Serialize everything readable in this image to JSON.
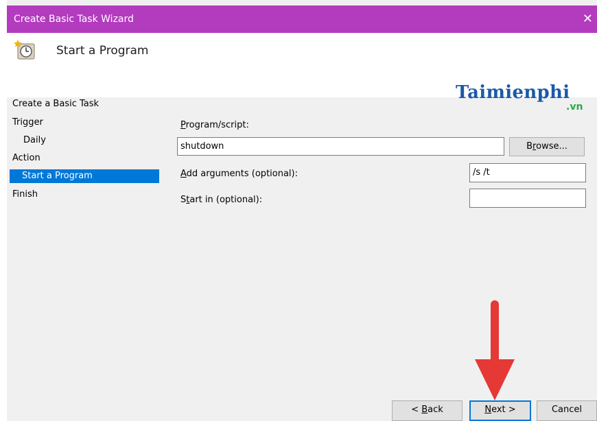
{
  "window": {
    "title": "Create Basic Task Wizard",
    "close_glyph": "✕"
  },
  "header": {
    "heading": "Start a Program"
  },
  "logo": {
    "text": "Taimienphi",
    "suffix": ".vn"
  },
  "nav": {
    "items": [
      {
        "label": "Create a Basic Task"
      },
      {
        "label": "Trigger"
      },
      {
        "label": "Daily"
      },
      {
        "label": "Action"
      },
      {
        "label": "Start a Program"
      },
      {
        "label": "Finish"
      }
    ]
  },
  "form": {
    "program_label_key": "P",
    "program_label_rest": "rogram/script:",
    "program_value": "shutdown",
    "browse_key": "r",
    "browse_pre": "B",
    "browse_post": "owse...",
    "args_label_key": "A",
    "args_label_rest": "dd arguments (optional):",
    "args_value": "/s /t",
    "startin_label_pre": "S",
    "startin_label_key": "t",
    "startin_label_rest": "art in (optional):",
    "startin_value": ""
  },
  "footer": {
    "back_pre": "< ",
    "back_key": "B",
    "back_rest": "ack",
    "next_key": "N",
    "next_rest": "ext >",
    "cancel_label": "Cancel"
  },
  "colors": {
    "titlebar": "#b33bbe",
    "selection": "#0078d7",
    "arrow": "#e53935"
  }
}
